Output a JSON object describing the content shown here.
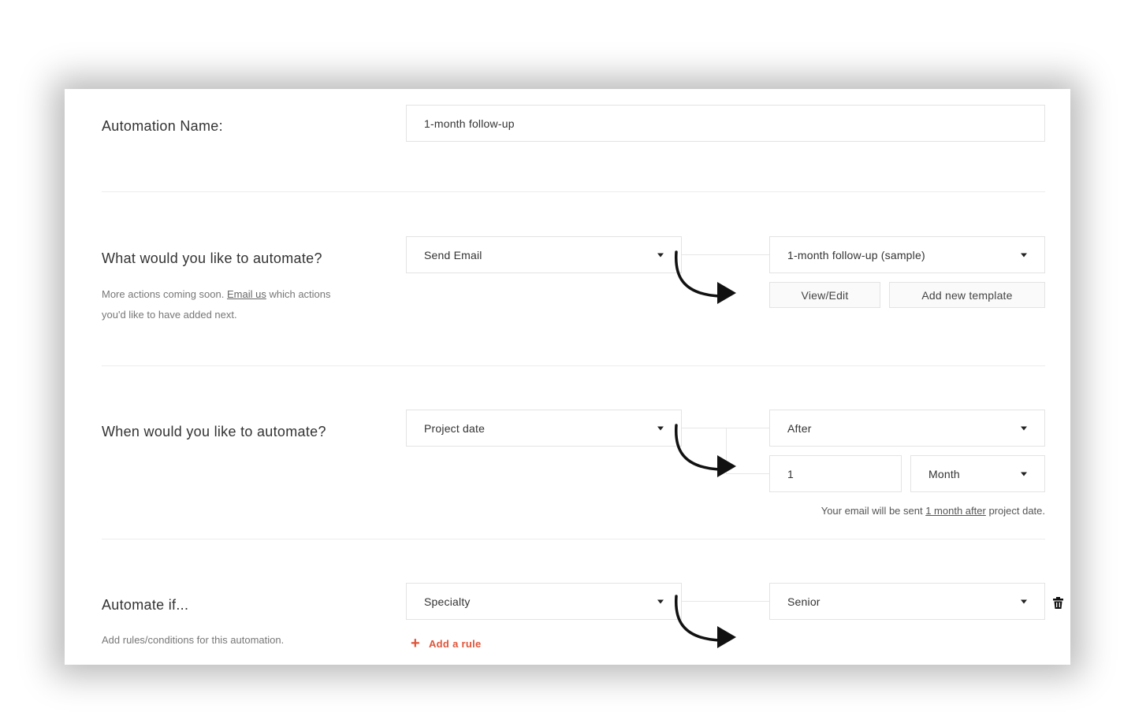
{
  "automation_name": {
    "label": "Automation Name:",
    "value": "1-month follow-up"
  },
  "what": {
    "label": "What would you like to automate?",
    "help_prefix": "More actions coming soon.",
    "help_link": "Email us",
    "help_suffix": "which actions",
    "help_line2": "you'd like to have added next.",
    "action_select": "Send Email",
    "template_select": "1-month follow-up (sample)",
    "view_edit_button": "View/Edit",
    "add_template_button": "Add new template"
  },
  "when": {
    "label": "When would you like to automate?",
    "trigger_select": "Project date",
    "timing_select": "After",
    "amount_input": "1",
    "unit_select": "Month",
    "summary_prefix": "Your email will be sent",
    "summary_link": "1 month after",
    "summary_suffix": "project date."
  },
  "condition": {
    "label": "Automate if...",
    "help": "Add rules/conditions for this automation.",
    "field_select": "Specialty",
    "value_select": "Senior",
    "add_rule_label": "Add a rule"
  },
  "icons": [
    "caret-down-icon",
    "trash-icon",
    "plus-icon",
    "curved-arrow-icon"
  ],
  "colors": {
    "accent": "#e0553a",
    "border": "#e3e3e3",
    "text": "#333333"
  }
}
